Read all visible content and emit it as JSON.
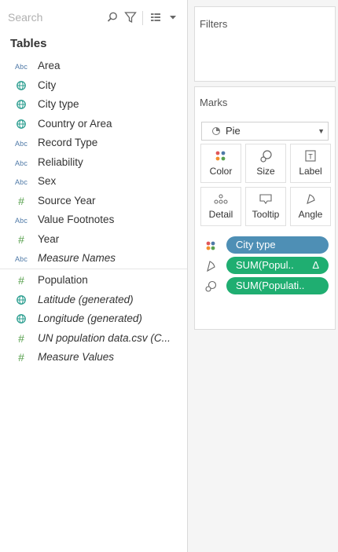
{
  "search": {
    "placeholder": "Search"
  },
  "icons": {
    "search": "search-icon",
    "filter": "filter-icon",
    "view": "view-toggle-icon",
    "dropdown": "chevron-down-icon"
  },
  "data_pane": {
    "title": "Tables",
    "fields": [
      {
        "type": "Abc",
        "label": "Area",
        "italic": false
      },
      {
        "type": "globe",
        "label": "City",
        "italic": false
      },
      {
        "type": "globe",
        "label": "City type",
        "italic": false
      },
      {
        "type": "globe",
        "label": "Country or Area",
        "italic": false
      },
      {
        "type": "Abc",
        "label": "Record Type",
        "italic": false
      },
      {
        "type": "Abc",
        "label": "Reliability",
        "italic": false
      },
      {
        "type": "Abc",
        "label": "Sex",
        "italic": false
      },
      {
        "type": "#",
        "label": "Source Year",
        "italic": false
      },
      {
        "type": "Abc",
        "label": "Value Footnotes",
        "italic": false
      },
      {
        "type": "#",
        "label": "Year",
        "italic": false
      },
      {
        "type": "Abc",
        "label": "Measure Names",
        "italic": true
      }
    ],
    "measures": [
      {
        "type": "#",
        "label": "Population",
        "italic": false
      },
      {
        "type": "globe",
        "label": "Latitude (generated)",
        "italic": true
      },
      {
        "type": "globe",
        "label": "Longitude (generated)",
        "italic": true
      },
      {
        "type": "#",
        "label": "UN population data.csv (C...",
        "italic": true
      },
      {
        "type": "#",
        "label": "Measure Values",
        "italic": true
      }
    ]
  },
  "filters": {
    "title": "Filters"
  },
  "marks": {
    "title": "Marks",
    "mark_type": "Pie",
    "buttons": [
      {
        "label": "Color",
        "icon": "color-icon"
      },
      {
        "label": "Size",
        "icon": "size-icon"
      },
      {
        "label": "Label",
        "icon": "label-icon"
      },
      {
        "label": "Detail",
        "icon": "detail-icon"
      },
      {
        "label": "Tooltip",
        "icon": "tooltip-icon"
      },
      {
        "label": "Angle",
        "icon": "angle-icon"
      }
    ],
    "pills": [
      {
        "icon": "color-icon",
        "label": "City type",
        "delta": "",
        "color": "#4e8fb5"
      },
      {
        "icon": "angle-icon",
        "label": "SUM(Popul..",
        "delta": "Δ",
        "color": "#1fae71"
      },
      {
        "icon": "size-icon",
        "label": "SUM(Populati..",
        "delta": "",
        "color": "#1fae71"
      }
    ]
  },
  "colors": {
    "dimension_pill": "#4e8fb5",
    "measure_pill": "#1fae71",
    "abc_icon": "#4e79a7",
    "measure_icon": "#59a14f"
  }
}
